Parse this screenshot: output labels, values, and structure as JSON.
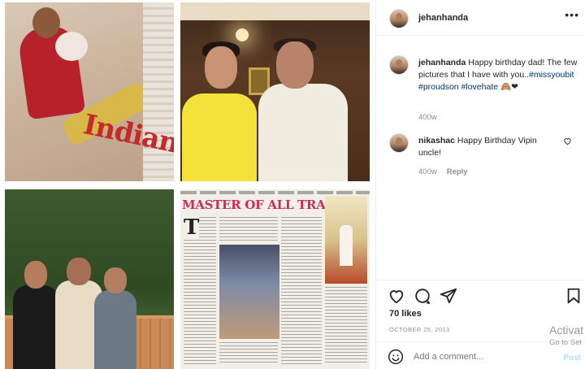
{
  "collage": {
    "photo1_caption": "Indian",
    "photo4_headline": "MASTER OF ALL TRADES?",
    "photo4_dropcap": "T"
  },
  "header": {
    "username": "jehanhanda",
    "more_icon": "more-horizontal-icon",
    "more_label": "•••"
  },
  "comments": [
    {
      "username": "jehanhanda",
      "text_before": " Happy birthday dad! The few pictures that I have with you..",
      "hashtags": [
        "#missyoubit",
        "#proudson",
        "#lovehate"
      ],
      "emoji": "🙈❤",
      "age": "400w"
    },
    {
      "username": "nikashac",
      "text": " Happy Birthday Vipin uncle!",
      "age": "400w",
      "reply_label": "Reply"
    }
  ],
  "actions": {
    "like_icon": "heart-icon",
    "comment_icon": "comment-bubble-icon",
    "share_icon": "paper-plane-icon",
    "save_icon": "bookmark-icon",
    "likes": "70 likes",
    "date": "OCTOBER 25, 2013"
  },
  "add_comment": {
    "placeholder": "Add a comment...",
    "post_label": "Post",
    "emoji_icon": "smiley-icon"
  },
  "watermark": {
    "line1": "Activat",
    "line2": "Go to Set"
  }
}
